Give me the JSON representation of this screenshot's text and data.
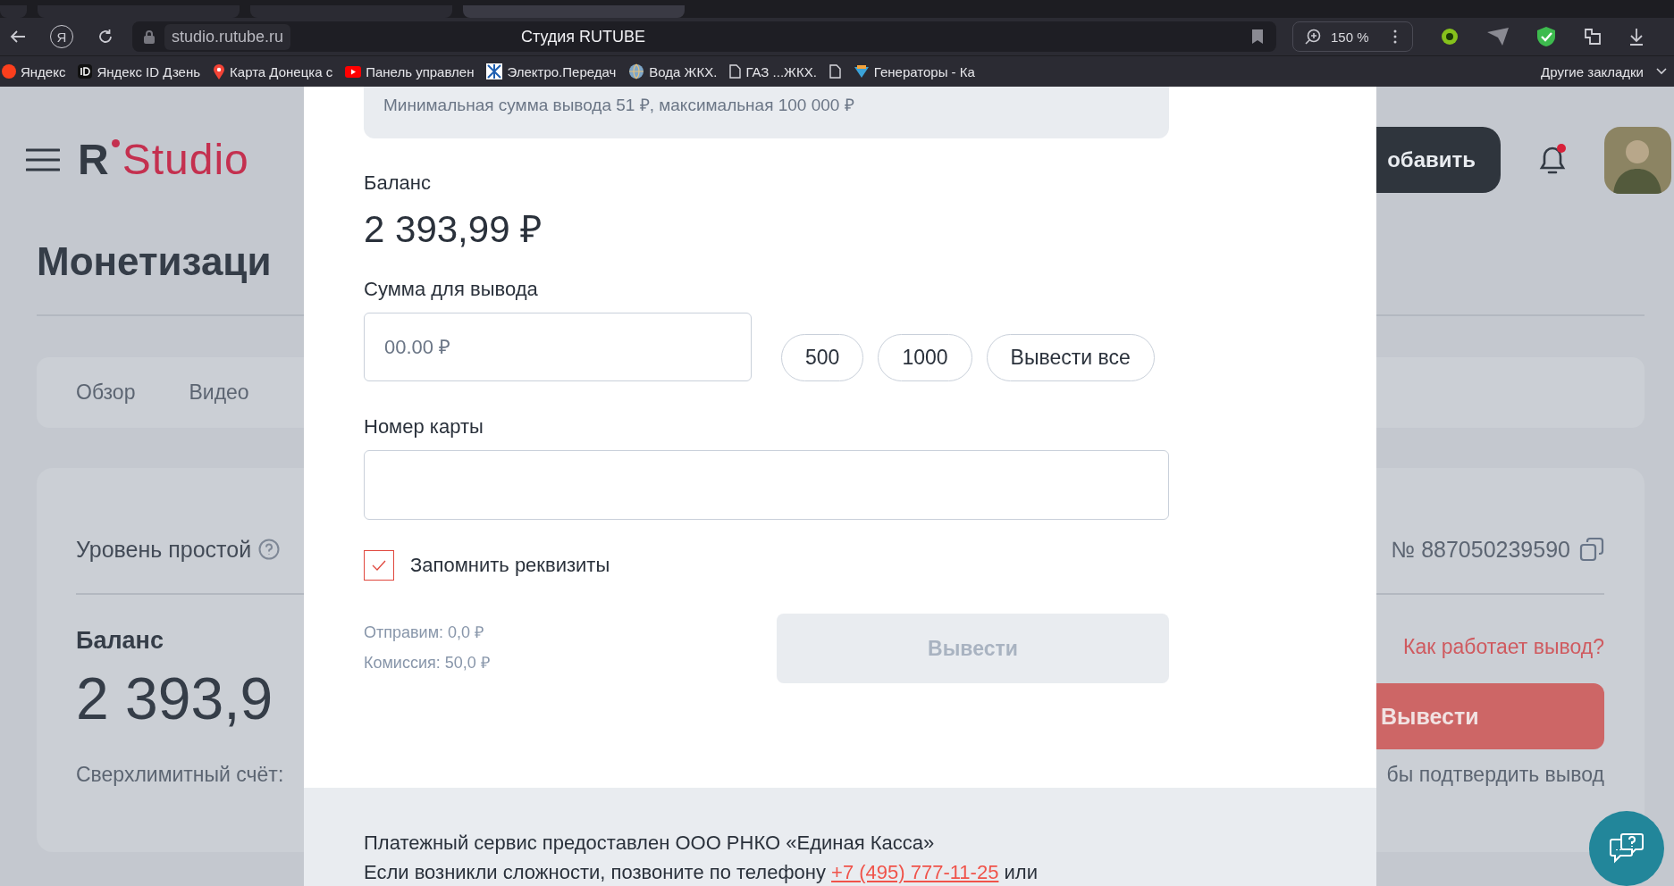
{
  "browser": {
    "tabs": [
      {
        "selected": false
      },
      {
        "selected": false
      },
      {
        "selected": false
      },
      {
        "selected": true
      }
    ],
    "profile_letter": "Я",
    "url": "studio.rutube.ru",
    "page_title": "Студия RUTUBE",
    "zoom": "150 %",
    "bookmarks": [
      {
        "label": "Яндекс",
        "kind": "yandex"
      },
      {
        "label": "Яндекс ID Дзень",
        "kind": "id"
      },
      {
        "label": "Карта Донецка с",
        "kind": "pin"
      },
      {
        "label": "Панель управлен",
        "kind": "video"
      },
      {
        "label": "Электро.Передач",
        "kind": "network"
      },
      {
        "label": "Вода  ЖКХ.",
        "kind": "globe"
      },
      {
        "label": "ГАЗ ...ЖКХ.",
        "kind": "doc"
      },
      {
        "kind": "doc"
      },
      {
        "label": "Генераторы - Ка",
        "kind": "fish"
      }
    ],
    "other_bookmarks": "Другие закладки"
  },
  "header": {
    "logo_letter": "R",
    "logo_text": "Studio",
    "add_button": "обавить",
    "notification_unread": true
  },
  "page": {
    "title": "Монетизаци",
    "tabs": [
      {
        "label": "Обзор"
      },
      {
        "label": "Видео"
      }
    ],
    "card": {
      "level": "Уровень простой",
      "account_number": "№ 887050239590",
      "balance_label": "Баланс",
      "balance": "2 393,9",
      "overlimit": "Сверхлимитный счёт:",
      "how_link": "Как работает вывод?",
      "withdraw_button": "Вывести",
      "confirm_hint": "бы подтвердить вывод"
    }
  },
  "modal": {
    "limits_note": "Минимальная сумма вывода 51 ₽, максимальная 100 000 ₽",
    "balance_label": "Баланс",
    "balance": "2 393,99 ₽",
    "amount_label": "Сумма для вывода",
    "amount_placeholder": "00.00 ₽",
    "presets": [
      "500",
      "1000",
      "Вывести все"
    ],
    "card_label": "Номер карты",
    "remember": {
      "label": "Запомнить реквизиты",
      "checked": true
    },
    "send": "Отправим: 0,0 ₽",
    "fee": "Комиссия: 50,0 ₽",
    "submit": {
      "label": "Вывести",
      "disabled": true
    },
    "footer": {
      "line1": "Платежный сервис предоставлен ООО РНКО «Единая Касса»",
      "line2_before": "Если возникли сложности, позвоните по телефону",
      "phone": "+7 (495) 777-11-25",
      "line2_after": "или"
    }
  }
}
